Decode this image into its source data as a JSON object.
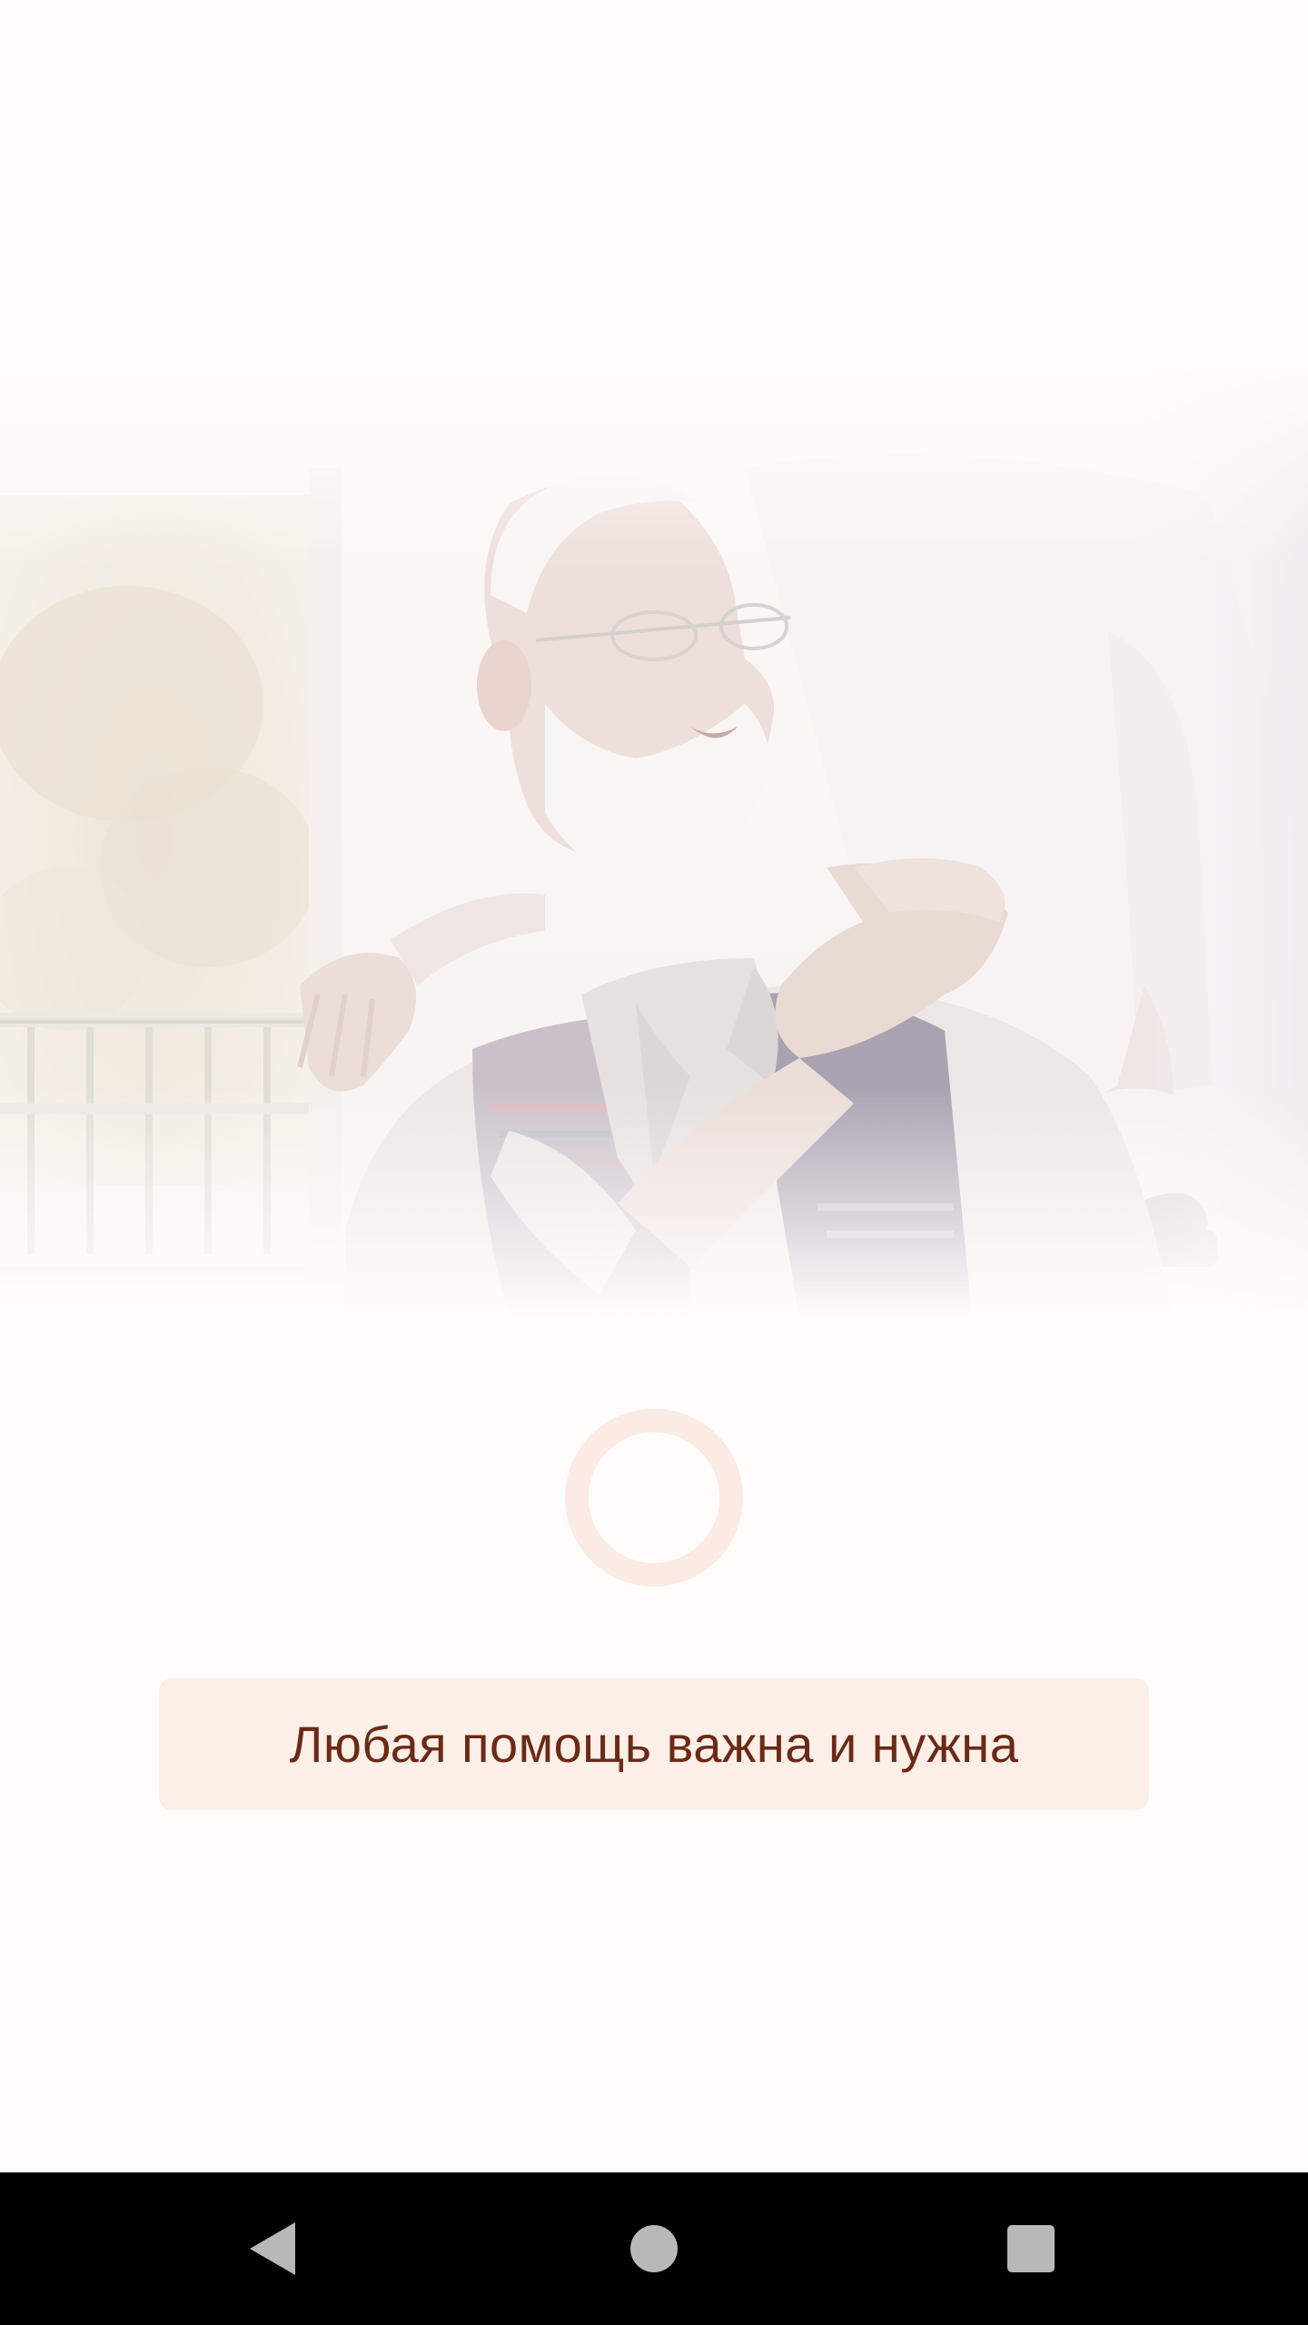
{
  "hero": {
    "image": "elderly-man-with-caregiver-photo"
  },
  "loading": {
    "icon": "loading-ring",
    "color": "#fcebe4"
  },
  "banner": {
    "text": "Любая помощь важна и нужна",
    "background": "#fcefe7",
    "text_color": "#6b2a16"
  },
  "navigation_bar": {
    "back_icon": "back-triangle-icon",
    "home_icon": "home-circle-icon",
    "recents_icon": "recents-square-icon"
  }
}
